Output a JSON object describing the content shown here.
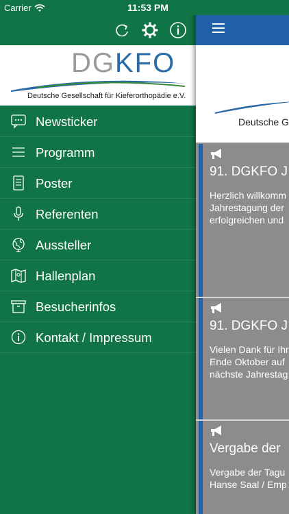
{
  "status_bar": {
    "carrier": "Carrier",
    "time": "11:53 PM"
  },
  "menu": {
    "logo": {
      "letters_dg": "DG",
      "letters_kfo": "KFO",
      "subtitle": "Deutsche Gesellschaft für Kieferorthopädie e.V."
    },
    "items": [
      {
        "label": "Newsticker",
        "icon": "chat-bubble-icon"
      },
      {
        "label": "Programm",
        "icon": "list-icon"
      },
      {
        "label": "Poster",
        "icon": "document-icon"
      },
      {
        "label": "Referenten",
        "icon": "microphone-icon"
      },
      {
        "label": "Aussteller",
        "icon": "globe-icon"
      },
      {
        "label": "Hallenplan",
        "icon": "map-icon"
      },
      {
        "label": "Besucherinfos",
        "icon": "archive-box-icon"
      },
      {
        "label": "Kontakt / Impressum",
        "icon": "info-icon"
      }
    ]
  },
  "main": {
    "logo_subtitle": "Deutsche G",
    "cards": [
      {
        "title": "91. DGKFO J",
        "lines": [
          "Herzlich willkomm",
          "Jahrestagung der",
          "erfolgreichen und"
        ]
      },
      {
        "title": "91. DGKFO J",
        "lines": [
          "Vielen Dank für Ihr",
          "Ende Oktober auf",
          "nächste Jahrestag"
        ]
      },
      {
        "title": "Vergabe der",
        "lines": [
          "Vergabe der Tagu",
          "Hanse Saal / Emp"
        ]
      }
    ]
  },
  "colors": {
    "menu_green": "#117446",
    "nav_blue": "#2060a8",
    "card_gray": "#8c8c8c"
  }
}
